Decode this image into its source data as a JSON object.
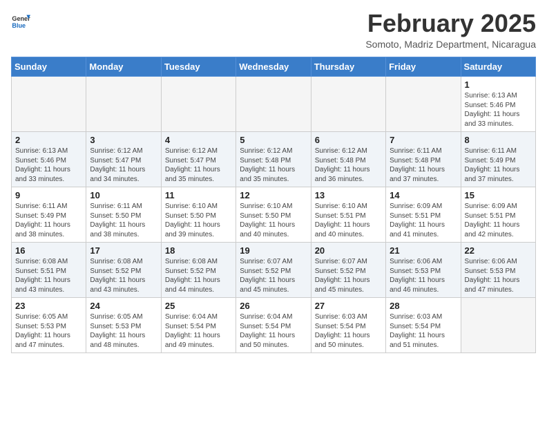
{
  "header": {
    "logo_general": "General",
    "logo_blue": "Blue",
    "month": "February 2025",
    "location": "Somoto, Madriz Department, Nicaragua"
  },
  "weekdays": [
    "Sunday",
    "Monday",
    "Tuesday",
    "Wednesday",
    "Thursday",
    "Friday",
    "Saturday"
  ],
  "weeks": [
    [
      {
        "day": "",
        "info": ""
      },
      {
        "day": "",
        "info": ""
      },
      {
        "day": "",
        "info": ""
      },
      {
        "day": "",
        "info": ""
      },
      {
        "day": "",
        "info": ""
      },
      {
        "day": "",
        "info": ""
      },
      {
        "day": "1",
        "info": "Sunrise: 6:13 AM\nSunset: 5:46 PM\nDaylight: 11 hours\nand 33 minutes."
      }
    ],
    [
      {
        "day": "2",
        "info": "Sunrise: 6:13 AM\nSunset: 5:46 PM\nDaylight: 11 hours\nand 33 minutes."
      },
      {
        "day": "3",
        "info": "Sunrise: 6:12 AM\nSunset: 5:47 PM\nDaylight: 11 hours\nand 34 minutes."
      },
      {
        "day": "4",
        "info": "Sunrise: 6:12 AM\nSunset: 5:47 PM\nDaylight: 11 hours\nand 35 minutes."
      },
      {
        "day": "5",
        "info": "Sunrise: 6:12 AM\nSunset: 5:48 PM\nDaylight: 11 hours\nand 35 minutes."
      },
      {
        "day": "6",
        "info": "Sunrise: 6:12 AM\nSunset: 5:48 PM\nDaylight: 11 hours\nand 36 minutes."
      },
      {
        "day": "7",
        "info": "Sunrise: 6:11 AM\nSunset: 5:48 PM\nDaylight: 11 hours\nand 37 minutes."
      },
      {
        "day": "8",
        "info": "Sunrise: 6:11 AM\nSunset: 5:49 PM\nDaylight: 11 hours\nand 37 minutes."
      }
    ],
    [
      {
        "day": "9",
        "info": "Sunrise: 6:11 AM\nSunset: 5:49 PM\nDaylight: 11 hours\nand 38 minutes."
      },
      {
        "day": "10",
        "info": "Sunrise: 6:11 AM\nSunset: 5:50 PM\nDaylight: 11 hours\nand 38 minutes."
      },
      {
        "day": "11",
        "info": "Sunrise: 6:10 AM\nSunset: 5:50 PM\nDaylight: 11 hours\nand 39 minutes."
      },
      {
        "day": "12",
        "info": "Sunrise: 6:10 AM\nSunset: 5:50 PM\nDaylight: 11 hours\nand 40 minutes."
      },
      {
        "day": "13",
        "info": "Sunrise: 6:10 AM\nSunset: 5:51 PM\nDaylight: 11 hours\nand 40 minutes."
      },
      {
        "day": "14",
        "info": "Sunrise: 6:09 AM\nSunset: 5:51 PM\nDaylight: 11 hours\nand 41 minutes."
      },
      {
        "day": "15",
        "info": "Sunrise: 6:09 AM\nSunset: 5:51 PM\nDaylight: 11 hours\nand 42 minutes."
      }
    ],
    [
      {
        "day": "16",
        "info": "Sunrise: 6:08 AM\nSunset: 5:51 PM\nDaylight: 11 hours\nand 43 minutes."
      },
      {
        "day": "17",
        "info": "Sunrise: 6:08 AM\nSunset: 5:52 PM\nDaylight: 11 hours\nand 43 minutes."
      },
      {
        "day": "18",
        "info": "Sunrise: 6:08 AM\nSunset: 5:52 PM\nDaylight: 11 hours\nand 44 minutes."
      },
      {
        "day": "19",
        "info": "Sunrise: 6:07 AM\nSunset: 5:52 PM\nDaylight: 11 hours\nand 45 minutes."
      },
      {
        "day": "20",
        "info": "Sunrise: 6:07 AM\nSunset: 5:52 PM\nDaylight: 11 hours\nand 45 minutes."
      },
      {
        "day": "21",
        "info": "Sunrise: 6:06 AM\nSunset: 5:53 PM\nDaylight: 11 hours\nand 46 minutes."
      },
      {
        "day": "22",
        "info": "Sunrise: 6:06 AM\nSunset: 5:53 PM\nDaylight: 11 hours\nand 47 minutes."
      }
    ],
    [
      {
        "day": "23",
        "info": "Sunrise: 6:05 AM\nSunset: 5:53 PM\nDaylight: 11 hours\nand 47 minutes."
      },
      {
        "day": "24",
        "info": "Sunrise: 6:05 AM\nSunset: 5:53 PM\nDaylight: 11 hours\nand 48 minutes."
      },
      {
        "day": "25",
        "info": "Sunrise: 6:04 AM\nSunset: 5:54 PM\nDaylight: 11 hours\nand 49 minutes."
      },
      {
        "day": "26",
        "info": "Sunrise: 6:04 AM\nSunset: 5:54 PM\nDaylight: 11 hours\nand 50 minutes."
      },
      {
        "day": "27",
        "info": "Sunrise: 6:03 AM\nSunset: 5:54 PM\nDaylight: 11 hours\nand 50 minutes."
      },
      {
        "day": "28",
        "info": "Sunrise: 6:03 AM\nSunset: 5:54 PM\nDaylight: 11 hours\nand 51 minutes."
      },
      {
        "day": "",
        "info": ""
      }
    ]
  ]
}
